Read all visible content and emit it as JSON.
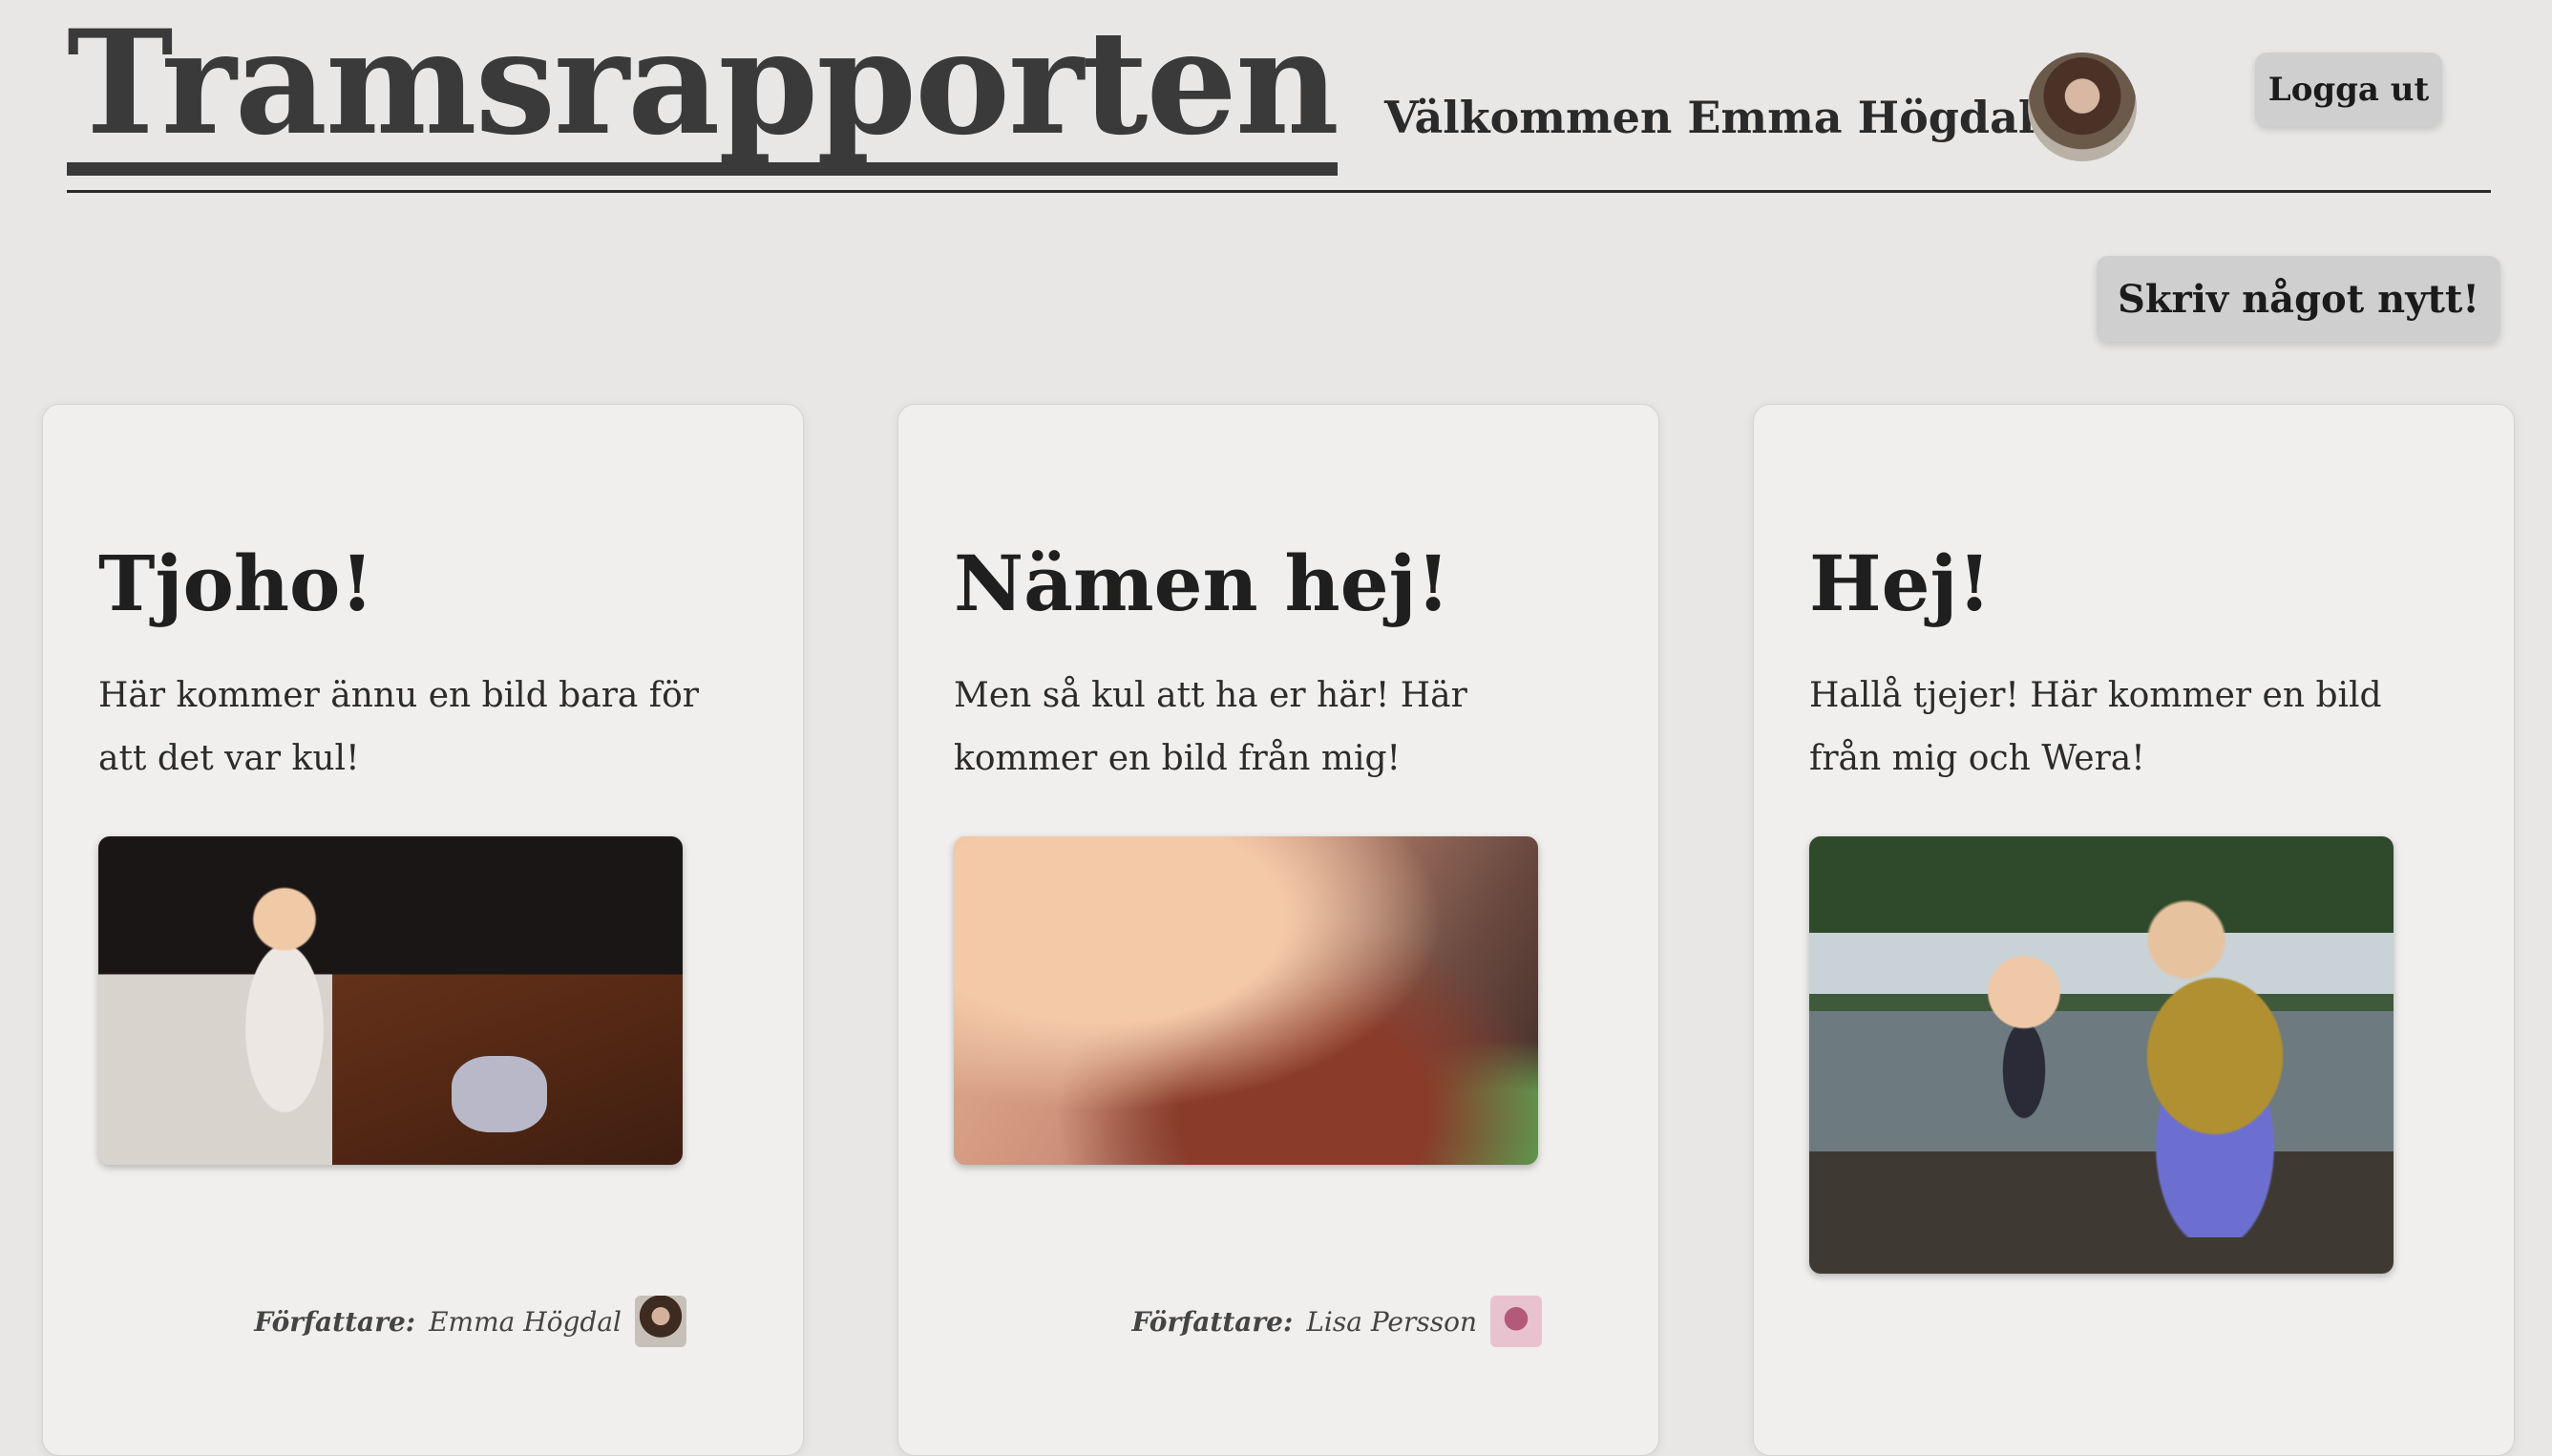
{
  "header": {
    "logo": "Tramsrapporten",
    "welcome": "Välkommen Emma Högdal!",
    "logout_label": "Logga ut"
  },
  "actions": {
    "new_post_label": "Skriv något nytt!"
  },
  "posts": [
    {
      "title": "Tjoho!",
      "body": "Här kommer ännu en bild bara för att det var kul!",
      "author_label": "Författare:",
      "author": "Emma Högdal"
    },
    {
      "title": "Nämen hej!",
      "body": "Men så kul att ha er här! Här kommer en bild från mig!",
      "author_label": "Författare:",
      "author": "Lisa Persson"
    },
    {
      "title": "Hej!",
      "body": "Hallå tjejer! Här kommer en bild från mig och Wera!"
    }
  ]
}
